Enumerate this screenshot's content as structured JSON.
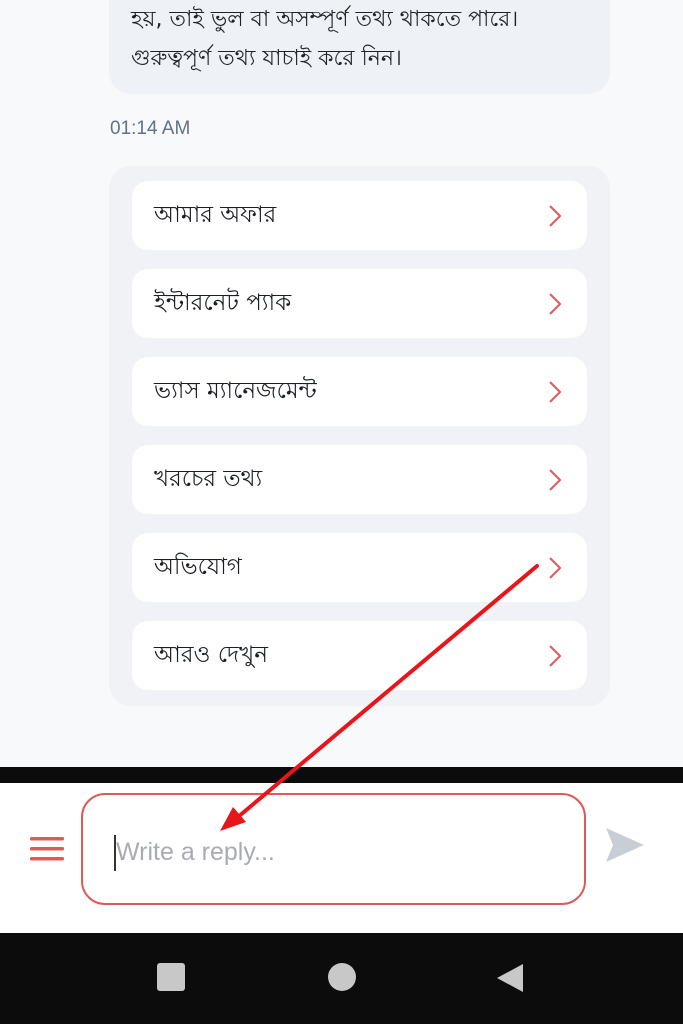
{
  "chat": {
    "bot_message_lines": [
      "হয়, তাই ভুল বা অসম্পূর্ণ তথ্য থাকতে পারে।",
      "গুরুত্বপূর্ণ তথ্য যাচাই করে নিন।"
    ],
    "timestamp": "01:14 AM",
    "menu_items": [
      {
        "label": "আমার অফার"
      },
      {
        "label": "ইন্টারনেট প্যাক"
      },
      {
        "label": "ভ্যাস ম্যানেজমেন্ট"
      },
      {
        "label": "খরচের তথ্য"
      },
      {
        "label": "অভিযোগ"
      },
      {
        "label": "আরও দেখুন"
      }
    ]
  },
  "composer": {
    "placeholder": "Write a reply...",
    "value": ""
  },
  "icons": {
    "menu": "hamburger-icon",
    "send": "send-icon",
    "item_arrow": "chevron-right-icon",
    "nav_recents": "square-icon",
    "nav_home": "circle-icon",
    "nav_back": "triangle-back-icon"
  },
  "colors": {
    "accent": "#dc5a5a",
    "annotation_arrow": "#e8161b",
    "send_disabled": "#c9ced6"
  }
}
